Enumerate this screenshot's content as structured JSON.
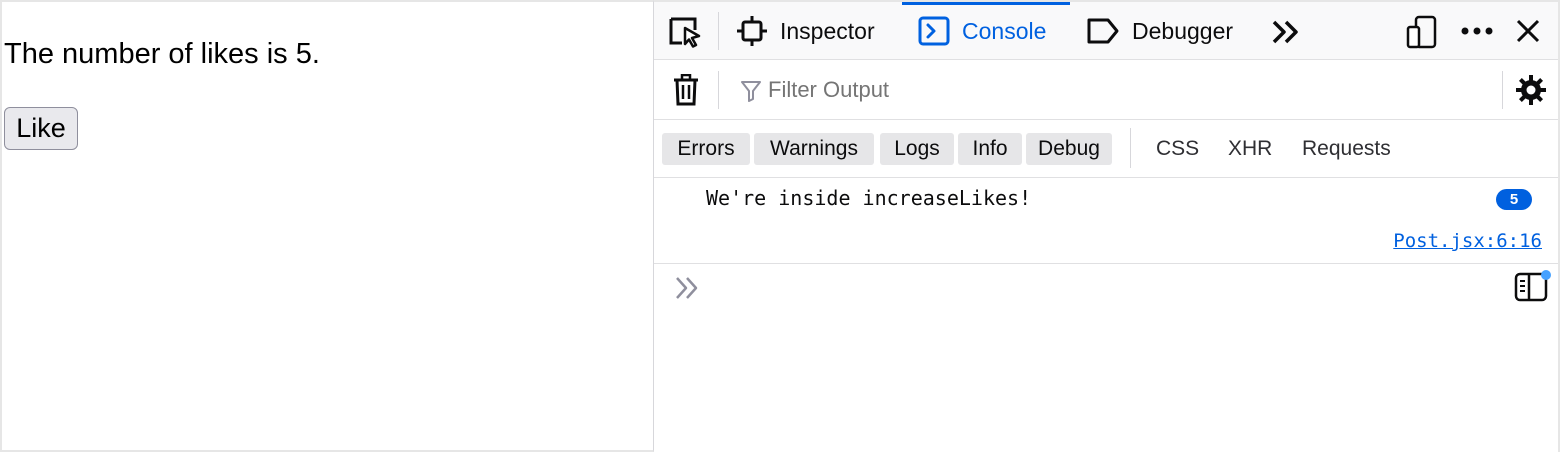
{
  "page": {
    "likes_text": "The number of likes is 5.",
    "like_button_label": "Like"
  },
  "devtools": {
    "tabs": [
      {
        "label": "Inspector",
        "icon": "inspector-icon"
      },
      {
        "label": "Console",
        "icon": "console-icon",
        "selected": true
      },
      {
        "label": "Debugger",
        "icon": "debugger-icon"
      }
    ],
    "filter": {
      "placeholder": "Filter Output",
      "value": ""
    },
    "levels": [
      "Errors",
      "Warnings",
      "Logs",
      "Info",
      "Debug"
    ],
    "request_filters": [
      "CSS",
      "XHR",
      "Requests"
    ],
    "messages": [
      {
        "text": "We're inside increaseLikes!",
        "repeat_count": "5",
        "location": "Post.jsx:6:16"
      }
    ],
    "colors": {
      "accent": "#0061e0",
      "badge": "#0060df",
      "link": "#0060df",
      "notification_dot": "#45a1ff"
    }
  }
}
